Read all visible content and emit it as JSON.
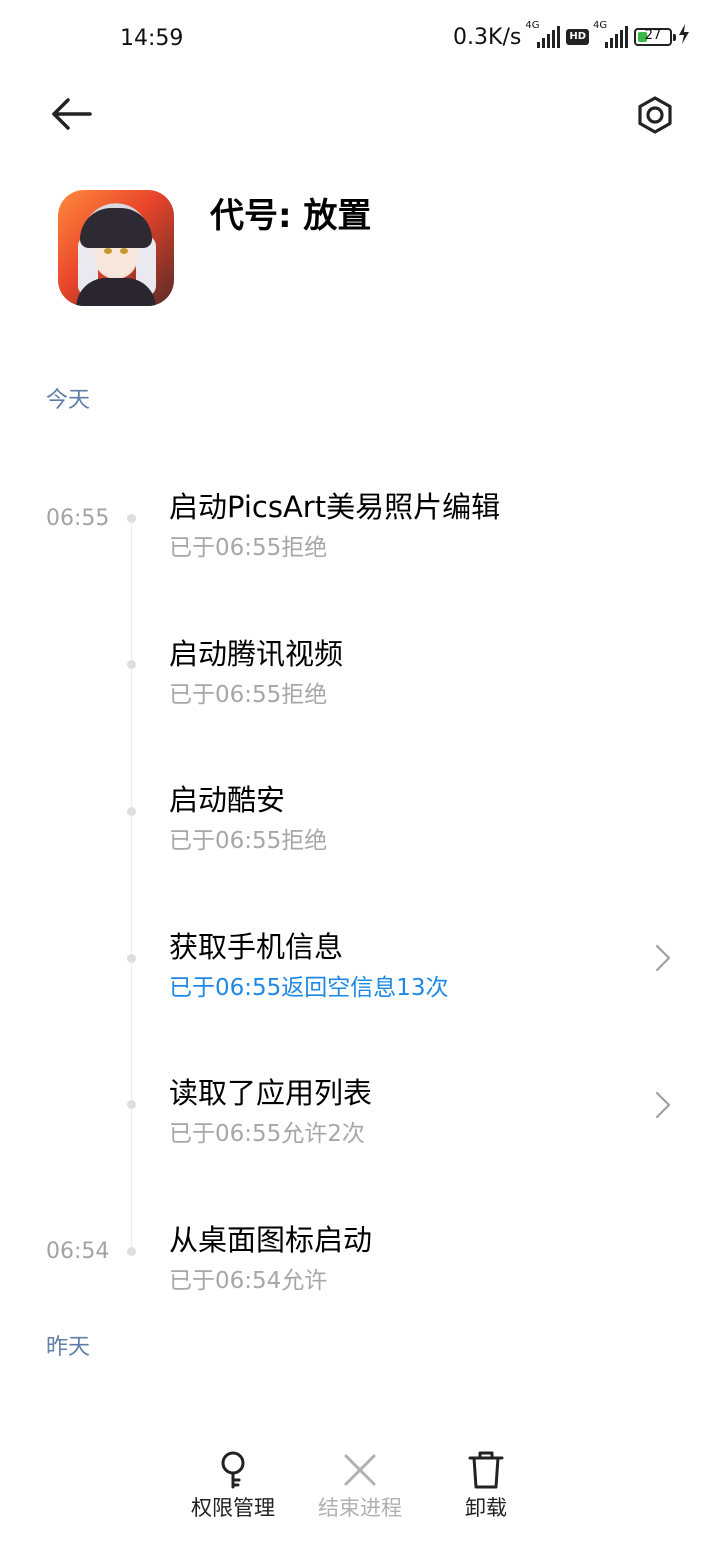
{
  "status_bar": {
    "time": "14:59",
    "net_speed": "0.3K/s",
    "sim1_tag": "4G",
    "hd_badge": "HD",
    "sim2_tag": "4G",
    "battery": "27"
  },
  "header": {
    "back_icon": "back-arrow-icon",
    "settings_icon": "settings-icon"
  },
  "app": {
    "name": "代号: 放置",
    "icon": "app-icon"
  },
  "sections": {
    "today": "今天",
    "yesterday": "昨天"
  },
  "events": [
    {
      "time": "06:55",
      "title": "启动PicsArt美易照片编辑",
      "subtitle": "已于06:55拒绝",
      "has_detail": false
    },
    {
      "time": "",
      "title": "启动腾讯视频",
      "subtitle": "已于06:55拒绝",
      "has_detail": false
    },
    {
      "time": "",
      "title": "启动酷安",
      "subtitle": "已于06:55拒绝",
      "has_detail": false
    },
    {
      "time": "",
      "title": "获取手机信息",
      "subtitle": "已于06:55返回空信息13次",
      "has_detail": true
    },
    {
      "time": "",
      "title": "读取了应用列表",
      "subtitle": "已于06:55允许2次",
      "has_detail": true
    },
    {
      "time": "06:54",
      "title": "从桌面图标启动",
      "subtitle": "已于06:54允许",
      "has_detail": false
    }
  ],
  "colors": {
    "accent_blue": "#1e88e5",
    "section_label": "#5f7ea6"
  },
  "bottom_bar": {
    "permissions": {
      "label": "权限管理",
      "icon": "key-icon"
    },
    "force_stop": {
      "label": "结束进程",
      "icon": "close-icon",
      "enabled": false
    },
    "uninstall": {
      "label": "卸载",
      "icon": "trash-icon"
    }
  }
}
